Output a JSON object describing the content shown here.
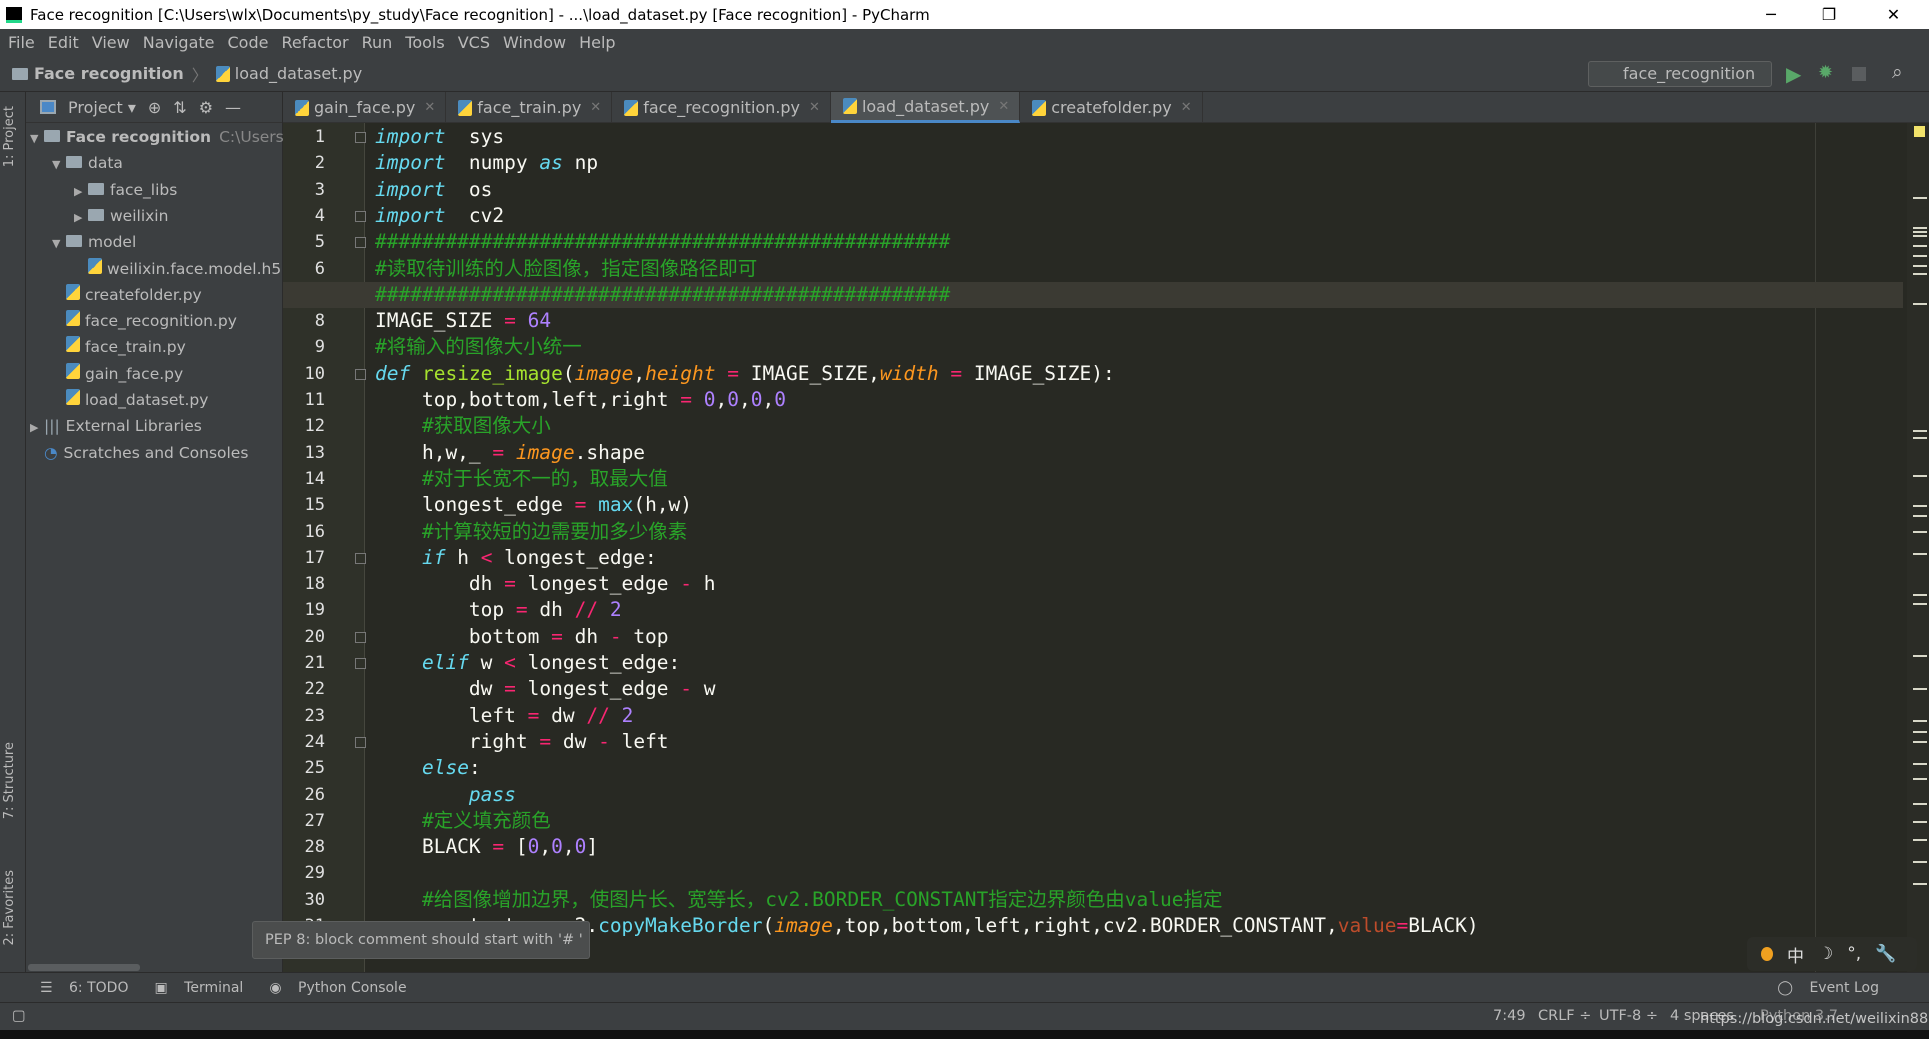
{
  "window": {
    "title": "Face recognition [C:\\Users\\wlx\\Documents\\py_study\\Face recognition] - ...\\load_dataset.py [Face recognition] - PyCharm",
    "logo": "PC"
  },
  "menu": [
    "File",
    "Edit",
    "View",
    "Navigate",
    "Code",
    "Refactor",
    "Run",
    "Tools",
    "VCS",
    "Window",
    "Help"
  ],
  "breadcrumb": {
    "project": "Face recognition",
    "file": "load_dataset.py"
  },
  "run_config": "face_recognition",
  "left_strip": {
    "project": "1: Project",
    "structure": "7: Structure",
    "favorites": "2: Favorites"
  },
  "project_panel": {
    "title": "Project",
    "tree": [
      {
        "label": "Face recognition",
        "extra": "C:\\Users\\w",
        "level": 0,
        "type": "folder",
        "arrow": "▼",
        "bold": true
      },
      {
        "label": "data",
        "level": 1,
        "type": "folder",
        "arrow": "▼"
      },
      {
        "label": "face_libs",
        "level": 2,
        "type": "folder",
        "arrow": "▶"
      },
      {
        "label": "weilixin",
        "level": 2,
        "type": "folder",
        "arrow": "▶"
      },
      {
        "label": "model",
        "level": 1,
        "type": "folder",
        "arrow": "▼"
      },
      {
        "label": "weilixin.face.model.h5",
        "level": 2,
        "type": "file",
        "arrow": ""
      },
      {
        "label": "createfolder.py",
        "level": 1,
        "type": "file",
        "arrow": ""
      },
      {
        "label": "face_recognition.py",
        "level": 1,
        "type": "file",
        "arrow": ""
      },
      {
        "label": "face_train.py",
        "level": 1,
        "type": "file",
        "arrow": ""
      },
      {
        "label": "gain_face.py",
        "level": 1,
        "type": "file",
        "arrow": ""
      },
      {
        "label": "load_dataset.py",
        "level": 1,
        "type": "file",
        "arrow": ""
      },
      {
        "label": "External Libraries",
        "level": 0,
        "type": "lib",
        "arrow": "▶"
      },
      {
        "label": "Scratches and Consoles",
        "level": 0,
        "type": "scratch",
        "arrow": ""
      }
    ]
  },
  "tabs": [
    {
      "label": "gain_face.py"
    },
    {
      "label": "face_train.py"
    },
    {
      "label": "face_recognition.py"
    },
    {
      "label": "load_dataset.py",
      "active": true
    },
    {
      "label": "createfolder.py"
    }
  ],
  "editor": {
    "current_line": 7,
    "lines": [
      [
        [
          "kw",
          "import"
        ],
        [
          "",
          "  sys"
        ]
      ],
      [
        [
          "kw",
          "import"
        ],
        [
          "",
          "  numpy "
        ],
        [
          "kw",
          "as"
        ],
        [
          "",
          " np"
        ]
      ],
      [
        [
          "kw",
          "import"
        ],
        [
          "",
          "  os"
        ]
      ],
      [
        [
          "kw",
          "import"
        ],
        [
          "",
          "  cv2"
        ]
      ],
      [
        [
          "cm",
          "#################################################"
        ]
      ],
      [
        [
          "cm",
          "#读取待训练的人脸图像，指定图像路径即可"
        ]
      ],
      [
        [
          "cm",
          "#################################################"
        ]
      ],
      [
        [
          "",
          "IMAGE_SIZE "
        ],
        [
          "op",
          "="
        ],
        [
          "",
          " "
        ],
        [
          "num",
          "64"
        ]
      ],
      [
        [
          "cm",
          "#将输入的图像大小统一"
        ]
      ],
      [
        [
          "kw",
          "def"
        ],
        [
          "",
          " "
        ],
        [
          "fn",
          "resize_image"
        ],
        [
          "",
          "("
        ],
        [
          "par",
          "image"
        ],
        [
          "",
          ","
        ],
        [
          "par",
          "height"
        ],
        [
          "",
          " "
        ],
        [
          "op",
          "="
        ],
        [
          "",
          " IMAGE_SIZE,"
        ],
        [
          "par",
          "width"
        ],
        [
          "",
          " "
        ],
        [
          "op",
          "="
        ],
        [
          "",
          " IMAGE_SIZE):"
        ]
      ],
      [
        [
          "",
          "    top,bottom,left,right "
        ],
        [
          "op",
          "="
        ],
        [
          "",
          " "
        ],
        [
          "num",
          "0"
        ],
        [
          "",
          ","
        ],
        [
          "num",
          "0"
        ],
        [
          "",
          ","
        ],
        [
          "num",
          "0"
        ],
        [
          "",
          ","
        ],
        [
          "num",
          "0"
        ]
      ],
      [
        [
          "cm",
          "    #获取图像大小"
        ]
      ],
      [
        [
          "",
          "    h,w,_ "
        ],
        [
          "op",
          "="
        ],
        [
          "",
          " "
        ],
        [
          "par",
          "image"
        ],
        [
          "",
          ".shape"
        ]
      ],
      [
        [
          "cm",
          "    #对于长宽不一的，取最大值"
        ]
      ],
      [
        [
          "",
          "    longest_edge "
        ],
        [
          "op",
          "="
        ],
        [
          "",
          " "
        ],
        [
          "bi",
          "max"
        ],
        [
          "",
          "(h,w)"
        ]
      ],
      [
        [
          "cm",
          "    #计算较短的边需要加多少像素"
        ]
      ],
      [
        [
          "",
          "    "
        ],
        [
          "kw",
          "if"
        ],
        [
          "",
          " h "
        ],
        [
          "op",
          "<"
        ],
        [
          "",
          " longest_edge:"
        ]
      ],
      [
        [
          "",
          "        dh "
        ],
        [
          "op",
          "="
        ],
        [
          "",
          " longest_edge "
        ],
        [
          "op",
          "-"
        ],
        [
          "",
          " h"
        ]
      ],
      [
        [
          "",
          "        top "
        ],
        [
          "op",
          "="
        ],
        [
          "",
          " dh "
        ],
        [
          "op",
          "//"
        ],
        [
          "",
          " "
        ],
        [
          "num",
          "2"
        ]
      ],
      [
        [
          "",
          "        bottom "
        ],
        [
          "op",
          "="
        ],
        [
          "",
          " dh "
        ],
        [
          "op",
          "-"
        ],
        [
          "",
          " top"
        ]
      ],
      [
        [
          "",
          "    "
        ],
        [
          "kw",
          "elif"
        ],
        [
          "",
          " w "
        ],
        [
          "op",
          "<"
        ],
        [
          "",
          " longest_edge:"
        ]
      ],
      [
        [
          "",
          "        dw "
        ],
        [
          "op",
          "="
        ],
        [
          "",
          " longest_edge "
        ],
        [
          "op",
          "-"
        ],
        [
          "",
          " w"
        ]
      ],
      [
        [
          "",
          "        left "
        ],
        [
          "op",
          "="
        ],
        [
          "",
          " dw "
        ],
        [
          "op",
          "//"
        ],
        [
          "",
          " "
        ],
        [
          "num",
          "2"
        ]
      ],
      [
        [
          "",
          "        right "
        ],
        [
          "op",
          "="
        ],
        [
          "",
          " dw "
        ],
        [
          "op",
          "-"
        ],
        [
          "",
          " left"
        ]
      ],
      [
        [
          "",
          "    "
        ],
        [
          "kw",
          "else"
        ],
        [
          "",
          ":"
        ]
      ],
      [
        [
          "",
          "        "
        ],
        [
          "kw",
          "pass"
        ]
      ],
      [
        [
          "cm",
          "    #定义填充颜色"
        ]
      ],
      [
        [
          "",
          "    BLACK "
        ],
        [
          "op",
          "="
        ],
        [
          "",
          " ["
        ],
        [
          "num",
          "0"
        ],
        [
          "",
          ","
        ],
        [
          "num",
          "0"
        ],
        [
          "",
          ","
        ],
        [
          "num",
          "0"
        ],
        [
          "",
          "]"
        ]
      ],
      [
        [
          "",
          ""
        ]
      ],
      [
        [
          "cm",
          "    #给图像增加边界，使图片长、宽等长，cv2.BORDER_CONSTANT指定边界颜色由value指定"
        ]
      ],
      [
        [
          "",
          "    constant "
        ],
        [
          "op",
          "="
        ],
        [
          "",
          " cv2."
        ],
        [
          "bi",
          "copyMakeBorder"
        ],
        [
          "",
          "("
        ],
        [
          "par",
          "image"
        ],
        [
          "",
          ",top,bottom,left,right,cv2.BORDER_CONSTANT,"
        ],
        [
          "kwarg",
          "value"
        ],
        [
          "op",
          "="
        ],
        [
          "",
          "BLACK)"
        ]
      ]
    ]
  },
  "tooltip": "PEP 8: block comment should start with '# '",
  "ime": {
    "mode": "中",
    "moon": "☽",
    "punct": "°,",
    "tool": "🔧"
  },
  "bottom_tools": {
    "todo": "6: TODO",
    "terminal": "Terminal",
    "python_console": "Python Console",
    "event_log": "Event Log"
  },
  "status": {
    "position": "7:49",
    "line_sep": "CRLF ÷",
    "encoding": "UTF-8 ÷",
    "indent": "4 spaces",
    "interpreter": "Python 3.7",
    "watermark": "https://blog.csdn.net/weilixin88"
  },
  "colors": {
    "background": "#282923",
    "keyword": "#66d9ef",
    "comment": "#29a329",
    "number": "#ae81ff",
    "operator": "#f92672",
    "param": "#fd971f",
    "accent": "#4a88c7"
  }
}
